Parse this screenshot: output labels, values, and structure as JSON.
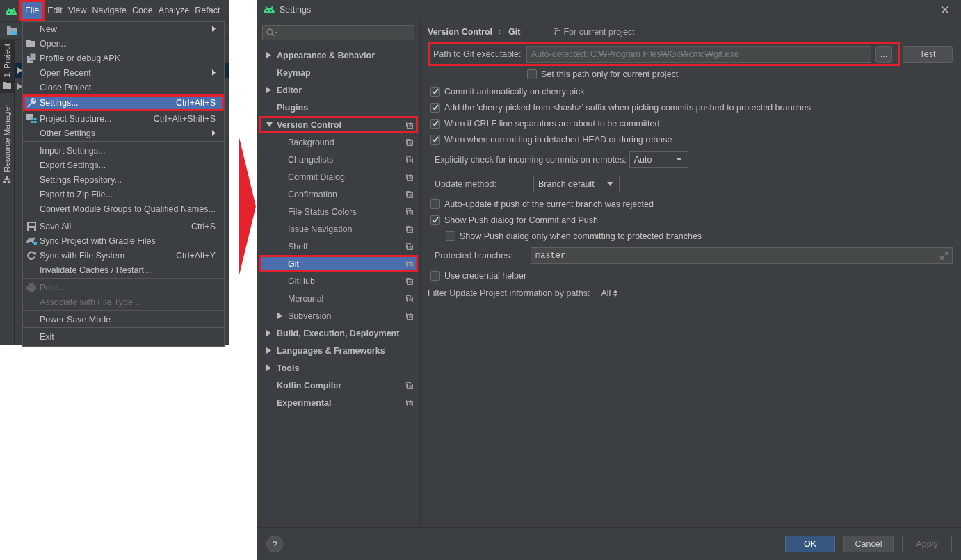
{
  "ide": {
    "menubar": [
      {
        "label": "File",
        "selected": true,
        "highlighted": true
      },
      {
        "label": "Edit",
        "selected": false,
        "highlighted": false
      },
      {
        "label": "View",
        "selected": false,
        "highlighted": false
      },
      {
        "label": "Navigate",
        "selected": false,
        "highlighted": false
      },
      {
        "label": "Code",
        "selected": false,
        "highlighted": false
      },
      {
        "label": "Analyze",
        "selected": false,
        "highlighted": false
      },
      {
        "label": "Refact",
        "selected": false,
        "highlighted": false
      }
    ],
    "tool_tabs": [
      {
        "label": "1: Project",
        "selected": true
      },
      {
        "label": "Resource Manager",
        "selected": false
      }
    ],
    "menu": [
      [
        {
          "label": "New",
          "submenu": true,
          "selected": false,
          "highlighted": false,
          "disabled": false
        },
        {
          "label": "Open...",
          "submenu": false,
          "selected": false,
          "highlighted": false,
          "disabled": false
        },
        {
          "label": "Profile or debug APK",
          "submenu": false,
          "selected": false,
          "highlighted": false,
          "disabled": false
        },
        {
          "label": "Open Recent",
          "submenu": true,
          "selected": false,
          "highlighted": false,
          "disabled": false
        },
        {
          "label": "Close Project",
          "submenu": false,
          "selected": false,
          "highlighted": false,
          "disabled": false
        },
        {
          "label": "Settings...",
          "shortcut": "Ctrl+Alt+S",
          "submenu": false,
          "selected": true,
          "highlighted": true,
          "disabled": false
        },
        {
          "label": "Project Structure...",
          "shortcut": "Ctrl+Alt+Shift+S",
          "submenu": false,
          "selected": false,
          "highlighted": false,
          "disabled": false
        },
        {
          "label": "Other Settings",
          "submenu": true,
          "selected": false,
          "highlighted": false,
          "disabled": false
        }
      ],
      [
        {
          "label": "Import Settings...",
          "submenu": false,
          "selected": false,
          "highlighted": false,
          "disabled": false
        },
        {
          "label": "Export Settings...",
          "submenu": false,
          "selected": false,
          "highlighted": false,
          "disabled": false
        },
        {
          "label": "Settings Repository...",
          "submenu": false,
          "selected": false,
          "highlighted": false,
          "disabled": false
        },
        {
          "label": "Export to Zip File...",
          "submenu": false,
          "selected": false,
          "highlighted": false,
          "disabled": false
        },
        {
          "label": "Convert Module Groups to Qualified Names...",
          "submenu": false,
          "selected": false,
          "highlighted": false,
          "disabled": false
        }
      ],
      [
        {
          "label": "Save All",
          "shortcut": "Ctrl+S",
          "submenu": false,
          "selected": false,
          "highlighted": false,
          "disabled": false
        },
        {
          "label": "Sync Project with Gradle Files",
          "submenu": false,
          "selected": false,
          "highlighted": false,
          "disabled": false
        },
        {
          "label": "Sync with File System",
          "shortcut": "Ctrl+Alt+Y",
          "submenu": false,
          "selected": false,
          "highlighted": false,
          "disabled": false
        },
        {
          "label": "Invalidate Caches / Restart...",
          "submenu": false,
          "selected": false,
          "highlighted": false,
          "disabled": false
        }
      ],
      [
        {
          "label": "Print...",
          "submenu": false,
          "selected": false,
          "highlighted": false,
          "disabled": true
        },
        {
          "label": "Associate with File Type...",
          "submenu": false,
          "selected": false,
          "highlighted": false,
          "disabled": true
        }
      ],
      [
        {
          "label": "Power Save Mode",
          "submenu": false,
          "selected": false,
          "highlighted": false,
          "disabled": false
        }
      ],
      [
        {
          "label": "Exit",
          "submenu": false,
          "selected": false,
          "highlighted": false,
          "disabled": false
        }
      ]
    ]
  },
  "dialog": {
    "title": "Settings",
    "tree": [
      {
        "label": "Appearance & Behavior",
        "kind": "group",
        "expanded": false,
        "selected": false,
        "highlighted": false,
        "project_scoped": false
      },
      {
        "label": "Keymap",
        "kind": "page",
        "selected": false,
        "highlighted": false,
        "project_scoped": false
      },
      {
        "label": "Editor",
        "kind": "group",
        "expanded": false,
        "selected": false,
        "highlighted": false,
        "project_scoped": false
      },
      {
        "label": "Plugins",
        "kind": "page",
        "selected": false,
        "highlighted": false,
        "project_scoped": false
      },
      {
        "label": "Version Control",
        "kind": "group",
        "expanded": true,
        "selected": false,
        "highlighted": true,
        "project_scoped": true,
        "children": [
          {
            "label": "Background",
            "kind": "page",
            "selected": false,
            "highlighted": false,
            "project_scoped": true
          },
          {
            "label": "Changelists",
            "kind": "page",
            "selected": false,
            "highlighted": false,
            "project_scoped": true
          },
          {
            "label": "Commit Dialog",
            "kind": "page",
            "selected": false,
            "highlighted": false,
            "project_scoped": true
          },
          {
            "label": "Confirmation",
            "kind": "page",
            "selected": false,
            "highlighted": false,
            "project_scoped": true
          },
          {
            "label": "File Status Colors",
            "kind": "page",
            "selected": false,
            "highlighted": false,
            "project_scoped": true
          },
          {
            "label": "Issue Navigation",
            "kind": "page",
            "selected": false,
            "highlighted": false,
            "project_scoped": true
          },
          {
            "label": "Shelf",
            "kind": "page",
            "selected": false,
            "highlighted": false,
            "project_scoped": true
          },
          {
            "label": "Git",
            "kind": "page",
            "selected": true,
            "highlighted": true,
            "project_scoped": true
          },
          {
            "label": "GitHub",
            "kind": "page",
            "selected": false,
            "highlighted": false,
            "project_scoped": true
          },
          {
            "label": "Mercurial",
            "kind": "page",
            "selected": false,
            "highlighted": false,
            "project_scoped": true
          },
          {
            "label": "Subversion",
            "kind": "group",
            "expanded": false,
            "selected": false,
            "highlighted": false,
            "project_scoped": true
          }
        ]
      },
      {
        "label": "Build, Execution, Deployment",
        "kind": "group",
        "expanded": false,
        "selected": false,
        "highlighted": false,
        "project_scoped": false
      },
      {
        "label": "Languages & Frameworks",
        "kind": "group",
        "expanded": false,
        "selected": false,
        "highlighted": false,
        "project_scoped": false
      },
      {
        "label": "Tools",
        "kind": "group",
        "expanded": false,
        "selected": false,
        "highlighted": false,
        "project_scoped": false
      },
      {
        "label": "Kotlin Compiler",
        "kind": "page",
        "selected": false,
        "highlighted": false,
        "project_scoped": true
      },
      {
        "label": "Experimental",
        "kind": "page",
        "selected": false,
        "highlighted": false,
        "project_scoped": true
      }
    ],
    "breadcrumb": [
      "Version Control",
      "Git"
    ],
    "scope_note": "For current project",
    "path_row": {
      "label": "Path to Git executable:",
      "placeholder": "Auto-detected: C:₩Program Files₩Git₩cmd₩git.exe",
      "browse": "...",
      "test": "Test",
      "highlighted": true,
      "project_only": {
        "label": "Set this path only for current project",
        "checked": false
      }
    },
    "options": [
      {
        "kind": "checkbox",
        "label": "Commit automatically on cherry-pick",
        "checked": true
      },
      {
        "kind": "checkbox",
        "label": "Add the 'cherry-picked from <hash>' suffix when picking commits pushed to protected branches",
        "checked": true
      },
      {
        "kind": "checkbox",
        "label": "Warn if CRLF line separators are about to be committed",
        "checked": true
      },
      {
        "kind": "checkbox",
        "label": "Warn when committing in detached HEAD or during rebase",
        "checked": true
      },
      {
        "kind": "dropdown",
        "label": "Explicitly check for incoming commits on remotes:",
        "value": "Auto",
        "aligned": false
      },
      {
        "kind": "dropdown",
        "label": "Update method:",
        "value": "Branch default",
        "aligned": true
      },
      {
        "kind": "checkbox",
        "label": "Auto-update if push of the current branch was rejected",
        "checked": false
      },
      {
        "kind": "checkbox",
        "label": "Show Push dialog for Commit and Push",
        "checked": true,
        "children": [
          {
            "kind": "checkbox",
            "label": "Show Push dialog only when committing to protected branches",
            "checked": false
          }
        ]
      },
      {
        "kind": "textfield",
        "label": "Protected branches:",
        "value": "master"
      },
      {
        "kind": "checkbox",
        "label": "Use credential helper",
        "checked": false
      },
      {
        "kind": "filter",
        "label": "Filter Update Project information by paths:",
        "value": "All"
      }
    ],
    "footer": {
      "help": "?",
      "buttons": [
        {
          "label": "OK",
          "default": true,
          "disabled": false
        },
        {
          "label": "Cancel",
          "default": false,
          "disabled": false
        },
        {
          "label": "Apply",
          "default": false,
          "disabled": true
        }
      ]
    }
  }
}
